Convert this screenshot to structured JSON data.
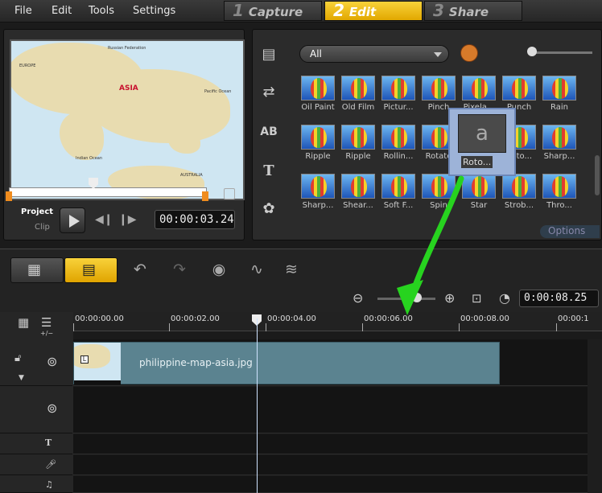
{
  "menu": [
    "File",
    "Edit",
    "Tools",
    "Settings"
  ],
  "steps": [
    {
      "num": "1",
      "label": "Capture"
    },
    {
      "num": "2",
      "label": "Edit"
    },
    {
      "num": "3",
      "label": "Share"
    }
  ],
  "preview": {
    "map_title": "ASIA",
    "map_labels": [
      "Russian Federation",
      "EUROPE",
      "Indian Ocean",
      "AUSTRALIA",
      "Pacific Ocean"
    ],
    "project_label": "Project",
    "clip_label": "Clip",
    "timecode": "00:00:03.24"
  },
  "library": {
    "category": "All",
    "effects_row1": [
      "Oil Paint",
      "Old Film",
      "Pictur...",
      "Pinch",
      "Pixela...",
      "Punch",
      "Rain"
    ],
    "effects_row2": [
      "Ripple",
      "Ripple",
      "Rollin...",
      "Rotate",
      "",
      "Roto...",
      "Sharp..."
    ],
    "effects_row3": [
      "Sharp...",
      "Shear...",
      "Soft F...",
      "Spin",
      "Star",
      "Strob...",
      "Thro..."
    ],
    "drag_label": "Roto...",
    "options_label": "Options"
  },
  "timeline": {
    "zoom_time": "0:00:08.25",
    "ruler": [
      "00:00:00.00",
      "00:00:02.00",
      "00:00:04.00",
      "00:00:06.00",
      "00:00:08.00",
      "00:00:1"
    ],
    "clip_name": "philippine-map-asia.jpg"
  }
}
